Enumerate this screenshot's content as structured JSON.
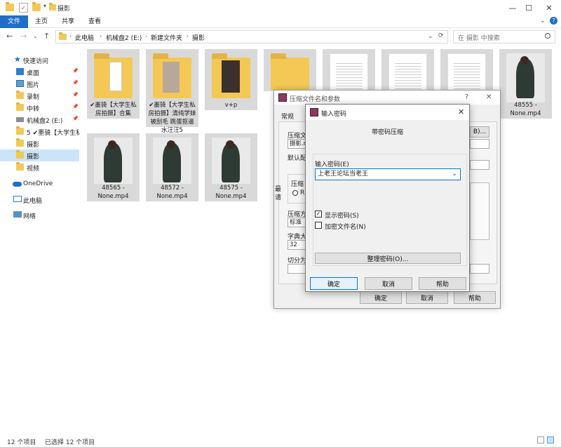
{
  "window": {
    "title": "摄影",
    "minimize": "—",
    "maximize": "☐",
    "close": "✕"
  },
  "ribbon": {
    "tabs": [
      "文件",
      "主页",
      "共享",
      "查看"
    ]
  },
  "nav": {
    "back": "←",
    "forward": "→",
    "recent": "⌄",
    "up": "↑",
    "refresh": "⟳",
    "dropdown": "⌄"
  },
  "address": {
    "crumbs": [
      "此电脑",
      "机械盘2 (E:)",
      "新建文件夹",
      "摄影"
    ],
    "sep": "›"
  },
  "search": {
    "placeholder": "在 摄影 中搜索",
    "icon": "search-icon"
  },
  "sidebar": {
    "quick_access": "快速访问",
    "items": [
      {
        "label": "桌面",
        "icon": "desktop-icon",
        "pinned": true
      },
      {
        "label": "图片",
        "icon": "pictures-icon",
        "pinned": true
      },
      {
        "label": "录制",
        "icon": "folder-icon",
        "pinned": true
      },
      {
        "label": "中转",
        "icon": "folder-icon",
        "pinned": true
      },
      {
        "label": "机械盘2 (E:)",
        "icon": "drive-icon",
        "pinned": true
      },
      {
        "label": "5 ✔墨骑【大学生私",
        "icon": "folder-icon",
        "pinned": false
      },
      {
        "label": "摄影",
        "icon": "folder-icon",
        "pinned": false
      },
      {
        "label": "摄影",
        "icon": "folder-icon",
        "pinned": false,
        "selected": true
      },
      {
        "label": "视频",
        "icon": "folder-icon",
        "pinned": false
      }
    ],
    "onedrive": "OneDrive",
    "thispc": "此电脑",
    "network": "网络",
    "pin_glyph": "📌"
  },
  "files": [
    {
      "name": "✔墨骑【大学生私房拍摄】合集",
      "kind": "folder"
    },
    {
      "name": "✔墨骑【大学生私房拍摄】清纯学妹被刮毛 跳蛋抠逼水汪汪5",
      "kind": "folder"
    },
    {
      "name": "v+p",
      "kind": "folder"
    },
    {
      "name": "",
      "kind": "folder"
    },
    {
      "name": "",
      "kind": "doc"
    },
    {
      "name": "",
      "kind": "doc"
    },
    {
      "name": "",
      "kind": "doc"
    },
    {
      "name": "48555 - None.mp4",
      "kind": "video"
    },
    {
      "name": "48565 - None.mp4",
      "kind": "video"
    },
    {
      "name": "48572 - None.mp4",
      "kind": "video"
    },
    {
      "name": "48575 - None.mp4",
      "kind": "video"
    }
  ],
  "status": {
    "count": "12 个项目",
    "selected": "已选择 12 个项目"
  },
  "archive_dialog": {
    "title": "压缩文件名和参数",
    "help": "?",
    "close": "✕",
    "tab_general": "常规",
    "archive_name_label": "压缩文",
    "archive_name_value": "摄影.r",
    "browse_button": "B)...",
    "default_label": "默认配",
    "format_label": "压缩",
    "format_option": "R",
    "method_label": "压缩方",
    "method_value": "标准",
    "dict_label": "字典大",
    "dict_value": "32",
    "split_label": "切分为",
    "side_text_1": "最",
    "side_text_2": "请",
    "ok": "确定",
    "cancel": "取消",
    "help_button": "帮助"
  },
  "password_dialog": {
    "title": "输入密码",
    "close": "✕",
    "heading": "带密码压缩",
    "enter_label": "输入密码(E)",
    "password_value": "上老王论坛当老王",
    "show_password": "显示密码(S)",
    "show_password_checked": true,
    "encrypt_names": "加密文件名(N)",
    "encrypt_names_checked": false,
    "organize_button": "整理密码(O)...",
    "ok": "确定",
    "cancel": "取消",
    "help": "帮助"
  },
  "colors": {
    "accent": "#1f6fc7",
    "selection": "#cce4f7",
    "folder": "#f3c855"
  }
}
